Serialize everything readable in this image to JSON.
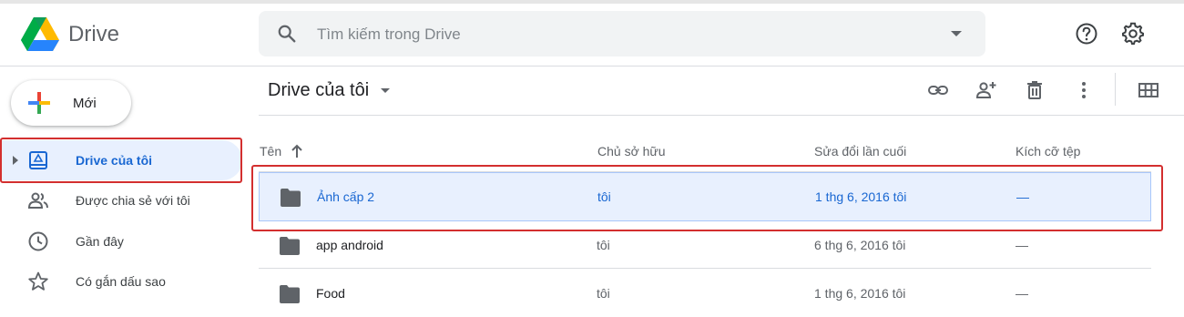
{
  "app": {
    "name": "Drive"
  },
  "search": {
    "placeholder": "Tìm kiếm trong Drive"
  },
  "header_icons": [
    "help-icon",
    "settings-icon"
  ],
  "new_button": {
    "label": "Mới"
  },
  "sidebar": {
    "items": [
      {
        "label": "Drive của tôi",
        "icon": "my-drive-icon",
        "active": true
      },
      {
        "label": "Được chia sẻ với tôi",
        "icon": "shared-people-icon"
      },
      {
        "label": "Gần đây",
        "icon": "clock-icon"
      },
      {
        "label": "Có gắn dấu sao",
        "icon": "star-icon"
      }
    ]
  },
  "main": {
    "title": "Drive của tôi",
    "toolbar": [
      "link-icon",
      "add-person-icon",
      "trash-icon",
      "more-vert-icon",
      "grid-view-icon"
    ],
    "columns": {
      "name": "Tên",
      "owner": "Chủ sở hữu",
      "modified": "Sửa đổi lần cuối",
      "size": "Kích cỡ tệp"
    },
    "rows": [
      {
        "name": "Ảnh cấp 2",
        "owner": "tôi",
        "modified": "1 thg 6, 2016 tôi",
        "size": "—",
        "selected": true
      },
      {
        "name": "app android",
        "owner": "tôi",
        "modified": "6 thg 6, 2016 tôi",
        "size": "—"
      },
      {
        "name": "Food",
        "owner": "tôi",
        "modified": "1 thg 6, 2016 tôi",
        "size": "—"
      }
    ]
  },
  "colors": {
    "accent": "#1967d2",
    "selected_bg": "#e8f0fe",
    "highlight_box": "#d32f2f"
  }
}
